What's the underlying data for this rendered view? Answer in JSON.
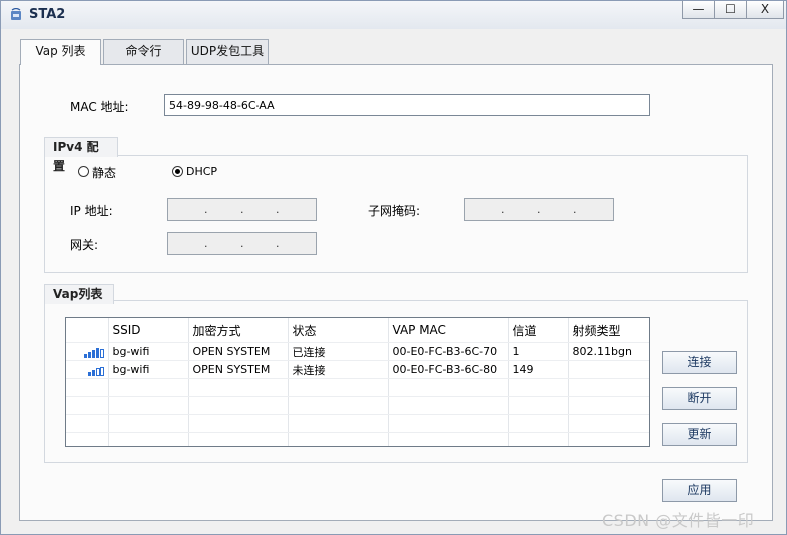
{
  "window": {
    "title": "STA2",
    "min_glyph": "—",
    "max_glyph": "☐",
    "close_glyph": "X"
  },
  "tabs": [
    {
      "label": "Vap 列表",
      "active": true
    },
    {
      "label": "命令行",
      "active": false
    },
    {
      "label": "UDP发包工具",
      "active": false
    }
  ],
  "mac": {
    "label": "MAC 地址:",
    "value": "54-89-98-48-6C-AA"
  },
  "ipv4": {
    "group_title": "IPv4 配置",
    "mode_static": "静态",
    "mode_dhcp": "DHCP",
    "selected": "DHCP",
    "ip_label": "IP 地址:",
    "mask_label": "子网掩码:",
    "gateway_label": "网关:",
    "dot": "."
  },
  "vap": {
    "group_title": "Vap列表",
    "columns": [
      "",
      "SSID",
      "加密方式",
      "状态",
      "VAP MAC",
      "信道",
      "射频类型"
    ],
    "rows": [
      {
        "signal": 4,
        "ssid": "bg-wifi",
        "encryption": "OPEN SYSTEM",
        "status": "已连接",
        "vap_mac": "00-E0-FC-B3-6C-70",
        "channel": "1",
        "radio": "802.11bgn"
      },
      {
        "signal": 2,
        "ssid": "bg-wifi",
        "encryption": "OPEN SYSTEM",
        "status": "未连接",
        "vap_mac": "00-E0-FC-B3-6C-80",
        "channel": "149",
        "radio": ""
      }
    ],
    "empty_rows": 4
  },
  "buttons": {
    "connect": "连接",
    "disconnect": "断开",
    "refresh": "更新",
    "apply": "应用"
  },
  "watermark": "CSDN @文件皆一印",
  "colors": {
    "signal": "#2b6fd6",
    "button_text": "#1e3a62"
  }
}
